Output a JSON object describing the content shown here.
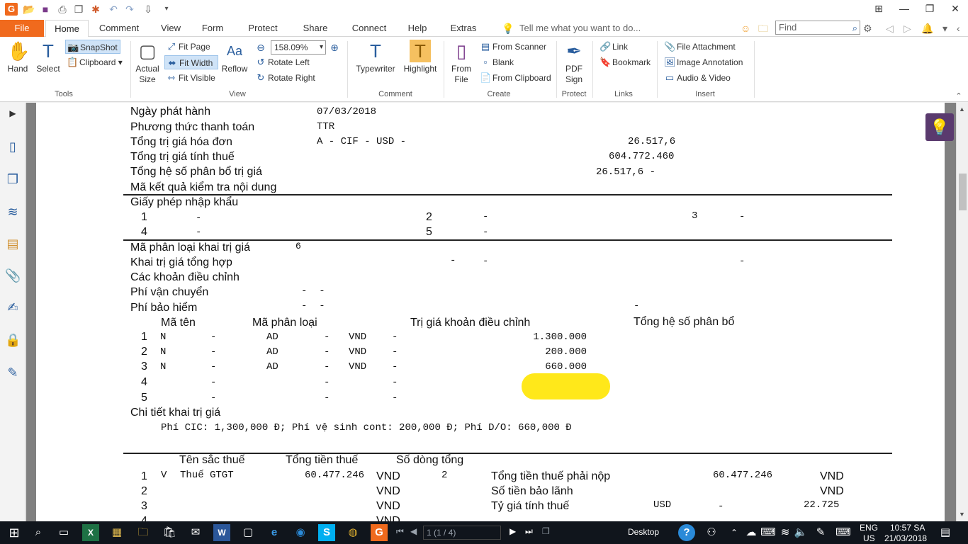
{
  "titlebar": {
    "quick_access": [
      "open-icon",
      "save-icon",
      "print-icon",
      "copy-icon",
      "new-icon",
      "undo-icon",
      "redo-icon",
      "stamp-icon"
    ],
    "window_controls": [
      "restore-layout-icon",
      "minimize-icon",
      "maximize-icon",
      "close-icon"
    ]
  },
  "menu": {
    "tabs": [
      "File",
      "Home",
      "Comment",
      "View",
      "Form",
      "Protect",
      "Share",
      "Connect",
      "Help",
      "Extras"
    ],
    "tell_me": "Tell me what you want to do...",
    "find_placeholder": "Find"
  },
  "ribbon": {
    "tools": {
      "hand": "Hand",
      "select": "Select",
      "snapshot": "SnapShot",
      "clipboard": "Clipboard",
      "label": "Tools"
    },
    "view": {
      "actual_size": "Actual Size",
      "fit_page": "Fit Page",
      "fit_width": "Fit Width",
      "fit_visible": "Fit Visible",
      "reflow": "Reflow",
      "zoom": "158.09%",
      "rotate_left": "Rotate Left",
      "rotate_right": "Rotate Right",
      "label": "View"
    },
    "comment": {
      "typewriter": "Typewriter",
      "highlight": "Highlight",
      "label": "Comment"
    },
    "create": {
      "from_file": "From File",
      "from_scanner": "From Scanner",
      "blank": "Blank",
      "from_clipboard": "From Clipboard",
      "label": "Create"
    },
    "protect": {
      "pdf_sign": "PDF Sign",
      "label": "Protect"
    },
    "links": {
      "link": "Link",
      "bookmark": "Bookmark",
      "label": "Links"
    },
    "insert": {
      "file_attachment": "File Attachment",
      "image_annotation": "Image Annotation",
      "audio_video": "Audio & Video",
      "label": "Insert"
    }
  },
  "sidebar": {
    "icons": [
      "expand-arrow-icon",
      "page-icon",
      "pages-icon",
      "layers-icon",
      "comments-icon",
      "attachment-icon",
      "signature-icon",
      "security-icon",
      "pen-icon"
    ]
  },
  "document": {
    "ngay_phat_hanh": {
      "label": "Ngày phát hành",
      "value": "07/03/2018"
    },
    "phuong_thuc": {
      "label": "Phương thức thanh toán",
      "value": "TTR"
    },
    "tong_tri_gia_hoa_don": {
      "label": "Tổng trị giá hóa đơn",
      "value": "A - CIF - USD -",
      "amount": "26.517,6"
    },
    "tong_tri_gia_tinh_thue": {
      "label": "Tổng trị giá tính thuế",
      "amount": "604.772.460"
    },
    "tong_he_so": {
      "label": "Tổng hệ số phân bổ trị giá",
      "amount": "26.517,6  -"
    },
    "ma_ket_qua": {
      "label": "Mã kết quả kiểm tra nội dung"
    },
    "giay_phep": {
      "label": "Giấy phép nhập khẩu",
      "rows": [
        {
          "n1": "1",
          "d1": "-",
          "n2": "2",
          "d2": "-",
          "n3": "3",
          "d3": "-"
        },
        {
          "n1": "4",
          "d1": "-",
          "n2": "5",
          "d2": "-"
        }
      ]
    },
    "ma_phan_loai": {
      "label": "Mã phân loại khai trị giá",
      "value": "6"
    },
    "khai_tri_gia": {
      "label": "Khai trị giá tổng hợp",
      "d1": "-",
      "d2": "-",
      "d3": "-"
    },
    "cac_khoan": {
      "label": "Các khoản điều chỉnh"
    },
    "phi_van_chuyen": {
      "label": "Phí vận chuyển",
      "value": "-  -"
    },
    "phi_bao_hiem": {
      "label": "Phí bảo hiểm",
      "value": "-  -",
      "extra": "-"
    },
    "adj_headers": {
      "ma_ten": "Mã tên",
      "ma_phan_loai": "Mã phân loại",
      "tri_gia": "Trị giá khoản điều chỉnh",
      "tong_he_so": "Tổng hệ số phân bổ"
    },
    "adj_rows": [
      {
        "no": "1",
        "code": "N",
        "d1": "-",
        "type": "AD",
        "d2": "-",
        "cur": "VND",
        "d3": "-",
        "amount": "1.300.000"
      },
      {
        "no": "2",
        "code": "N",
        "d1": "-",
        "type": "AD",
        "d2": "-",
        "cur": "VND",
        "d3": "-",
        "amount": "200.000"
      },
      {
        "no": "3",
        "code": "N",
        "d1": "-",
        "type": "AD",
        "d2": "-",
        "cur": "VND",
        "d3": "-",
        "amount": "660.000"
      },
      {
        "no": "4",
        "code": "",
        "d1": "-",
        "type": "",
        "d2": "-",
        "cur": "",
        "d3": "-",
        "amount": ""
      },
      {
        "no": "5",
        "code": "",
        "d1": "-",
        "type": "",
        "d2": "-",
        "cur": "",
        "d3": "-",
        "amount": ""
      }
    ],
    "chi_tiet": {
      "label": "Chi tiết khai trị giá",
      "value": "Phí CIC: 1,300,000 Đ; Phí vệ sinh cont: 200,000 Đ; Phí D/O: 660,000 Đ"
    },
    "tax_headers": {
      "ten_sac_thue": "Tên sắc thuế",
      "tong_tien_thue": "Tổng tiền thuế",
      "so_dong": "Số dòng tổng"
    },
    "tax_rows": [
      {
        "no": "1",
        "code": "V",
        "name": "Thuế GTGT",
        "amount": "60.477.246",
        "cur": "VND",
        "lines": "2"
      },
      {
        "no": "2",
        "code": "",
        "name": "",
        "amount": "",
        "cur": "VND",
        "lines": ""
      },
      {
        "no": "3",
        "code": "",
        "name": "",
        "amount": "",
        "cur": "VND",
        "lines": ""
      },
      {
        "no": "4",
        "code": "",
        "name": "",
        "amount": "",
        "cur": "VND",
        "lines": ""
      }
    ],
    "tong_tien_thue_phai_nop": {
      "label": "Tổng tiền thuế phải nộp",
      "amount": "60.477.246",
      "cur": "VND"
    },
    "so_tien_bao_lanh": {
      "label": "Số tiền bảo lãnh",
      "cur": "VND"
    },
    "ty_gia": {
      "label": "Tỷ giá tính thuế",
      "cur": "USD",
      "dash": "-",
      "value": "22.725"
    },
    "highlight_color": "#ffe81a"
  },
  "taskbar": {
    "pdf_page": "1 (1 / 4)",
    "desktop": "Desktop",
    "lang": "ENG",
    "region": "US",
    "time": "10:57 SA",
    "date": "21/03/2018"
  }
}
